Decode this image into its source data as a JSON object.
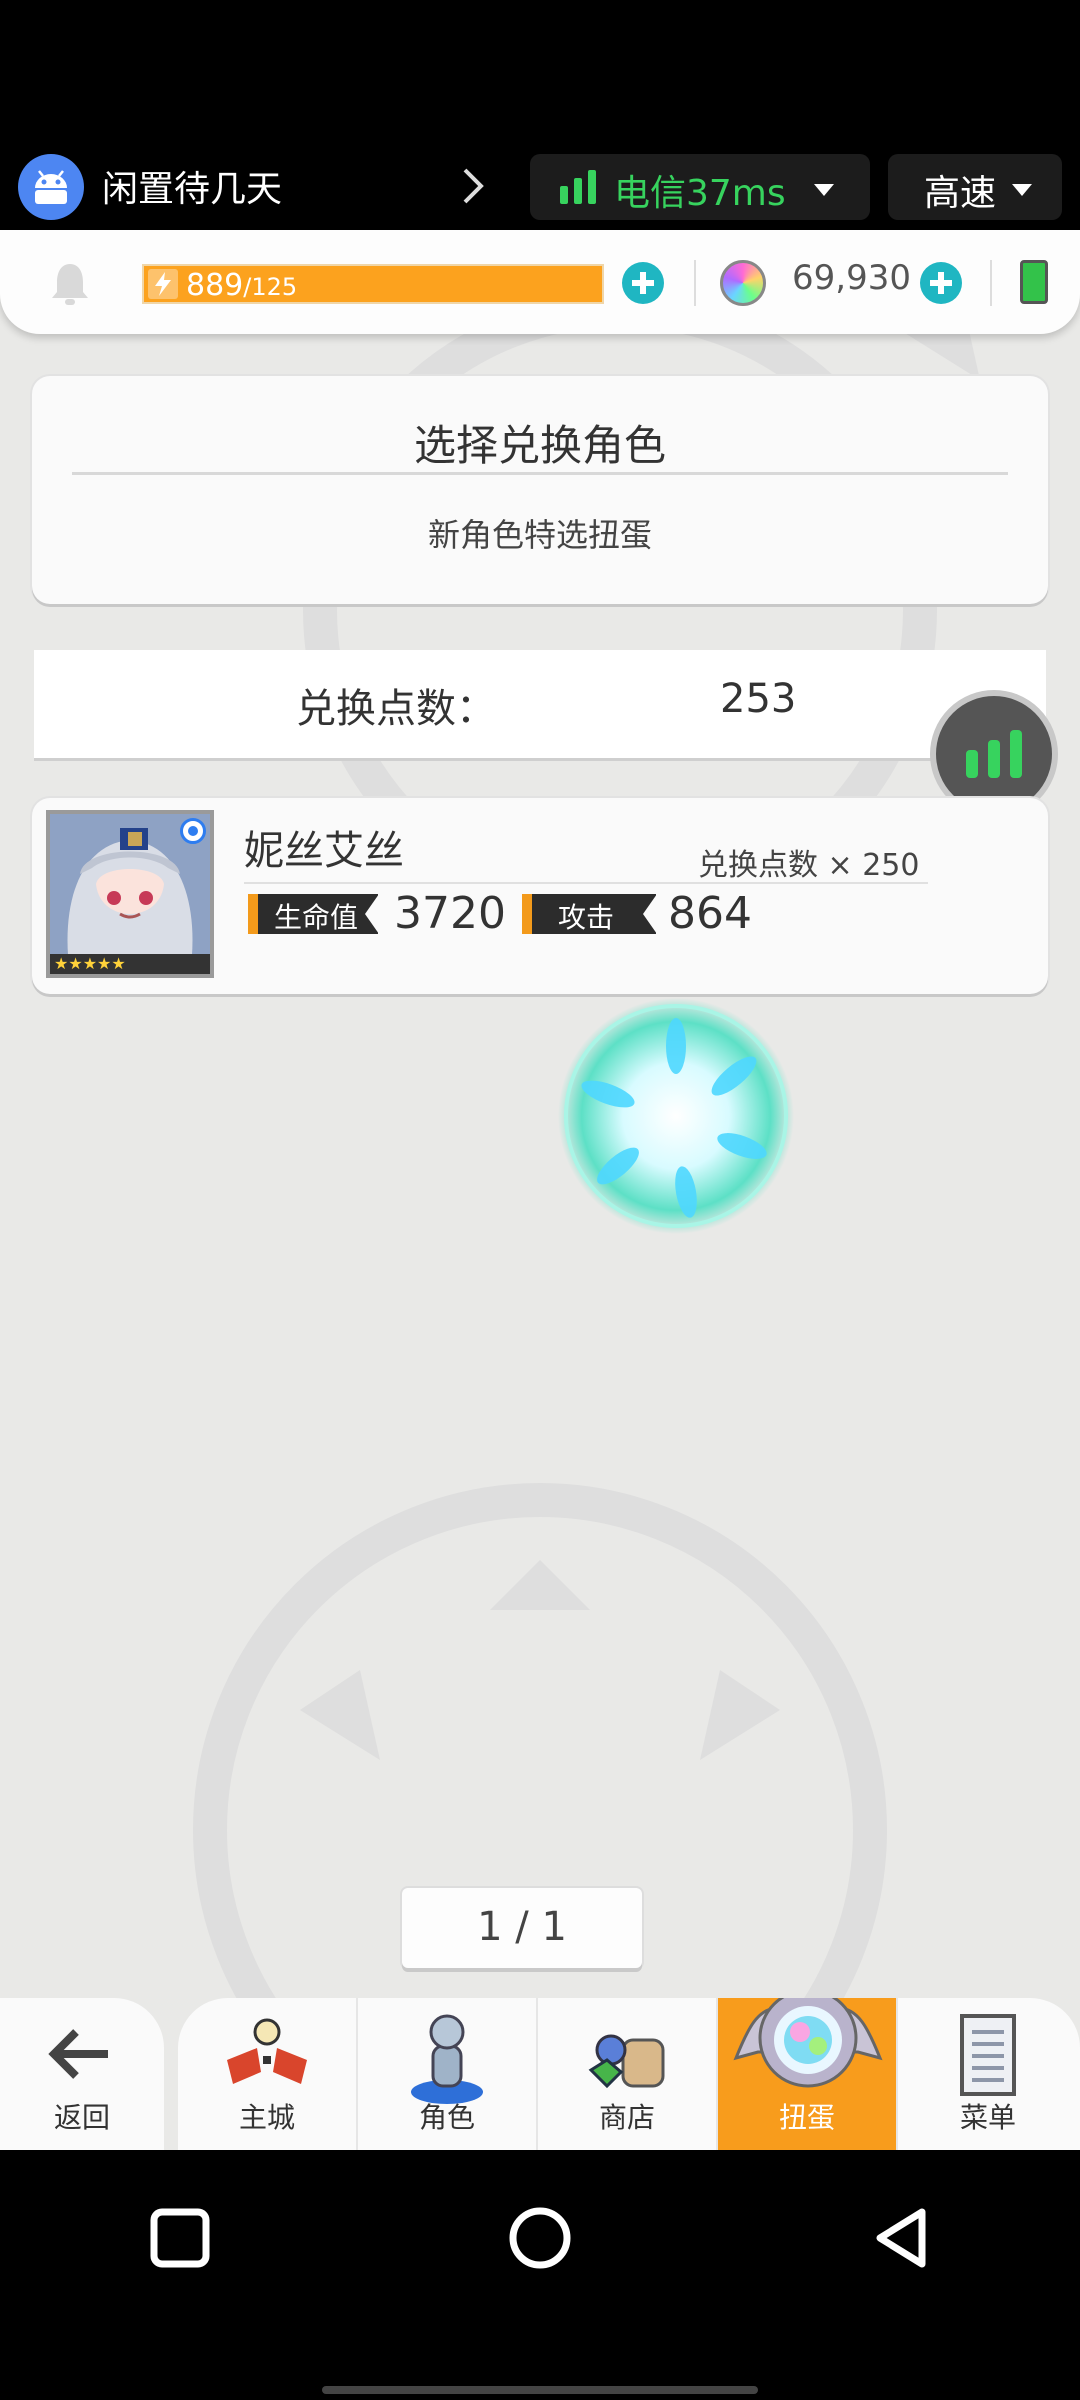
{
  "overlay": {
    "app_name": "闲置待几天",
    "network_text": "电信37ms",
    "speed_label": "高速"
  },
  "resources": {
    "energy_current": "889",
    "energy_max": "/125",
    "gems": "69,930"
  },
  "exchange_card": {
    "title": "选择兑换角色",
    "subtitle": "新角色特选扭蛋"
  },
  "points": {
    "label": "兑换点数：",
    "value": "253"
  },
  "character": {
    "name": "妮丝艾丝",
    "cost": "兑换点数 × 250",
    "hp_label": "生命值",
    "hp_value": "3720",
    "atk_label": "攻击",
    "atk_value": "864",
    "stars": 5
  },
  "pager": {
    "text": "1 / 1"
  },
  "nav": {
    "back": "返回",
    "items": [
      {
        "label": "主城",
        "icon": "town-icon"
      },
      {
        "label": "角色",
        "icon": "character-icon"
      },
      {
        "label": "商店",
        "icon": "shop-icon"
      },
      {
        "label": "扭蛋",
        "icon": "gacha-icon",
        "active": true
      },
      {
        "label": "菜单",
        "icon": "menu-icon"
      }
    ]
  },
  "colors": {
    "accent_orange": "#f89c1c",
    "teal": "#1fb6c2",
    "network_green": "#37d35e"
  }
}
